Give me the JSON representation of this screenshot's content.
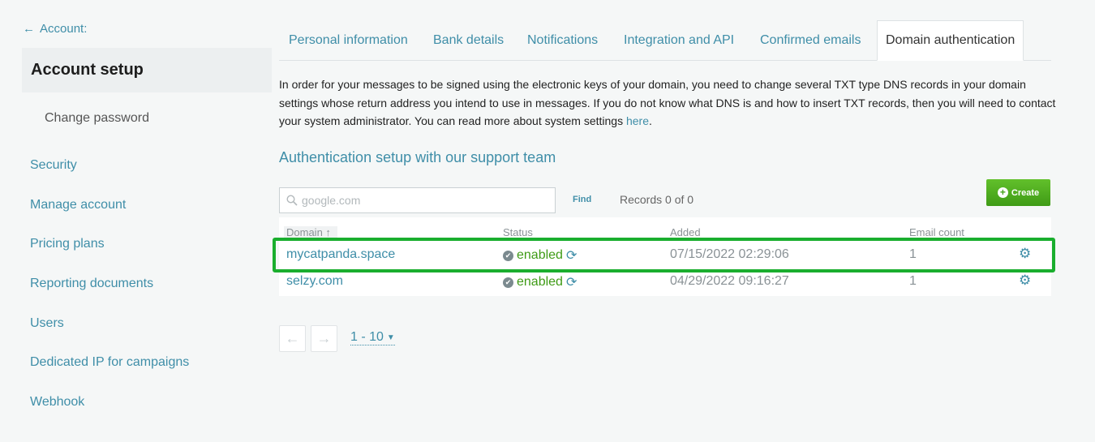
{
  "sidebar": {
    "back_label": "Account:",
    "header": "Account setup",
    "sub_item": "Change password",
    "items": [
      {
        "label": "Security"
      },
      {
        "label": "Manage account"
      },
      {
        "label": "Pricing plans"
      },
      {
        "label": "Reporting documents"
      },
      {
        "label": "Users"
      },
      {
        "label": "Dedicated IP for campaigns"
      },
      {
        "label": "Webhook"
      }
    ]
  },
  "tabs": [
    {
      "label": "Personal information"
    },
    {
      "label": "Bank details"
    },
    {
      "label": "Notifications"
    },
    {
      "label": "Integration and API"
    },
    {
      "label": "Confirmed emails"
    },
    {
      "label": "Domain authentication"
    }
  ],
  "active_tab": "Domain authentication",
  "description": {
    "text": "In order for your messages to be signed using the electronic keys of your domain, you need to change several TXT type DNS records in your domain settings whose return address you intend to use in messages. If you do not know what DNS is and how to insert TXT records, then you will need to contact your system administrator. You can read more about system settings ",
    "link": "here",
    "suffix": "."
  },
  "section_title": "Authentication setup with our support team",
  "search": {
    "placeholder": "google.com",
    "value": "",
    "find_label": "Find",
    "records_text": "Records 0 of 0"
  },
  "create_label": "Create",
  "table": {
    "columns": {
      "domain": "Domain ↑",
      "status": "Status",
      "added": "Added",
      "email_count": "Email count"
    },
    "rows": [
      {
        "domain": "mycatpanda.space",
        "status": "enabled",
        "added": "07/15/2022 02:29:06",
        "email_count": "1"
      },
      {
        "domain": "selzy.com",
        "status": "enabled",
        "added": "04/29/2022 09:16:27",
        "email_count": "1"
      }
    ]
  },
  "pagination": {
    "range": "1 - 10"
  },
  "colors": {
    "accent": "#3f8ea8",
    "success": "#3f9b16",
    "highlight": "#1aae2e"
  }
}
